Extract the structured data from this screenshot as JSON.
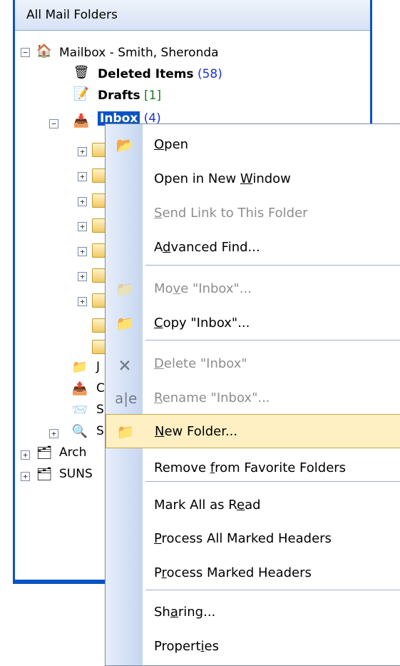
{
  "pane": {
    "title": "All Mail Folders",
    "tree": {
      "mailbox": "Mailbox - Smith, Sheronda",
      "deleted_label": "Deleted Items",
      "deleted_count": "(58)",
      "drafts_label": "Drafts",
      "drafts_count": "[1]",
      "inbox_label": "Inbox",
      "inbox_count": "(4)",
      "peek": [
        "J",
        "C",
        "S",
        "S"
      ],
      "archive_partial": "Arch",
      "suns_partial": "SUNS"
    }
  },
  "menu": {
    "items": [
      {
        "pre": "",
        "u": "O",
        "post": "pen",
        "disabled": false
      },
      {
        "pre": "Open in New ",
        "u": "W",
        "post": "indow",
        "disabled": false
      },
      {
        "pre": "",
        "u": "S",
        "post": "end Link to This Folder",
        "disabled": true
      },
      {
        "pre": "A",
        "u": "d",
        "post": "vanced Find...",
        "disabled": false
      },
      {
        "pre": "Mo",
        "u": "v",
        "post": "e \"Inbox\"...",
        "disabled": true
      },
      {
        "pre": "",
        "u": "C",
        "post": "opy \"Inbox\"...",
        "disabled": false
      },
      {
        "pre": "",
        "u": "D",
        "post": "elete \"Inbox\"",
        "disabled": true
      },
      {
        "pre": "",
        "u": "R",
        "post": "ename \"Inbox\"...",
        "disabled": true
      },
      {
        "pre": "",
        "u": "N",
        "post": "ew Folder...",
        "disabled": false
      },
      {
        "pre": "Remove ",
        "u": "f",
        "post": "rom Favorite Folders",
        "disabled": false
      },
      {
        "pre": "Mark All as R",
        "u": "e",
        "post": "ad",
        "disabled": false
      },
      {
        "pre": "",
        "u": "P",
        "post": "rocess All Marked Headers",
        "disabled": false
      },
      {
        "pre": "P",
        "u": "r",
        "post": "ocess Marked Headers",
        "disabled": false
      },
      {
        "pre": "Sh",
        "u": "a",
        "post": "ring...",
        "disabled": false
      },
      {
        "pre": "Propert",
        "u": "i",
        "post": "es",
        "disabled": false
      }
    ],
    "highlighted_index": 8,
    "colors": {
      "highlight_bg": "#fff0c4",
      "highlight_border": "#c7a54a",
      "disabled_text": "#8d8d8d",
      "pane_border": "#0a53c4"
    }
  }
}
